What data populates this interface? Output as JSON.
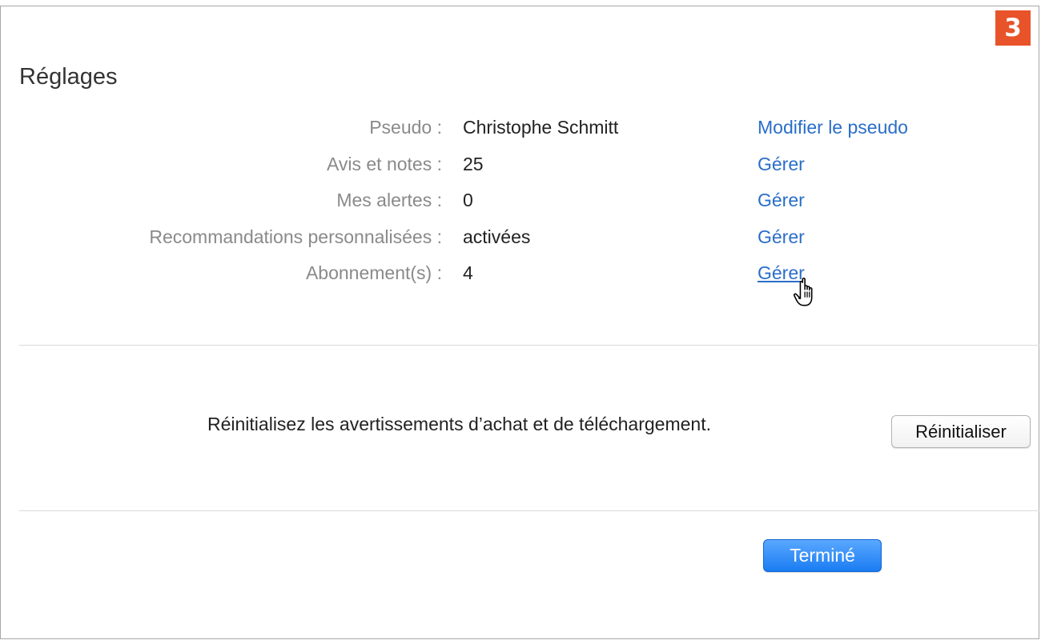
{
  "step_badge": "3",
  "page_title": "Réglages",
  "settings": [
    {
      "label": "Pseudo :",
      "value": "Christophe Schmitt",
      "action": "Modifier le pseudo"
    },
    {
      "label": "Avis et notes :",
      "value": "25",
      "action": "Gérer"
    },
    {
      "label": "Mes alertes :",
      "value": "0",
      "action": "Gérer"
    },
    {
      "label": "Recommandations personnalisées :",
      "value": "activées",
      "action": "Gérer"
    },
    {
      "label": "Abonnement(s) :",
      "value": "4",
      "action": "Gérer"
    }
  ],
  "reset": {
    "description": "Réinitialisez les avertissements d’achat et de téléchargement.",
    "button_label": "Réinitialiser"
  },
  "footer": {
    "done_label": "Terminé"
  },
  "colors": {
    "link": "#2a6ec9",
    "badge": "#e8532a",
    "primary_button": "#1a7cf2",
    "label_gray": "#8a8a8a"
  },
  "icons": {
    "cursor": "hand-pointer-icon"
  }
}
